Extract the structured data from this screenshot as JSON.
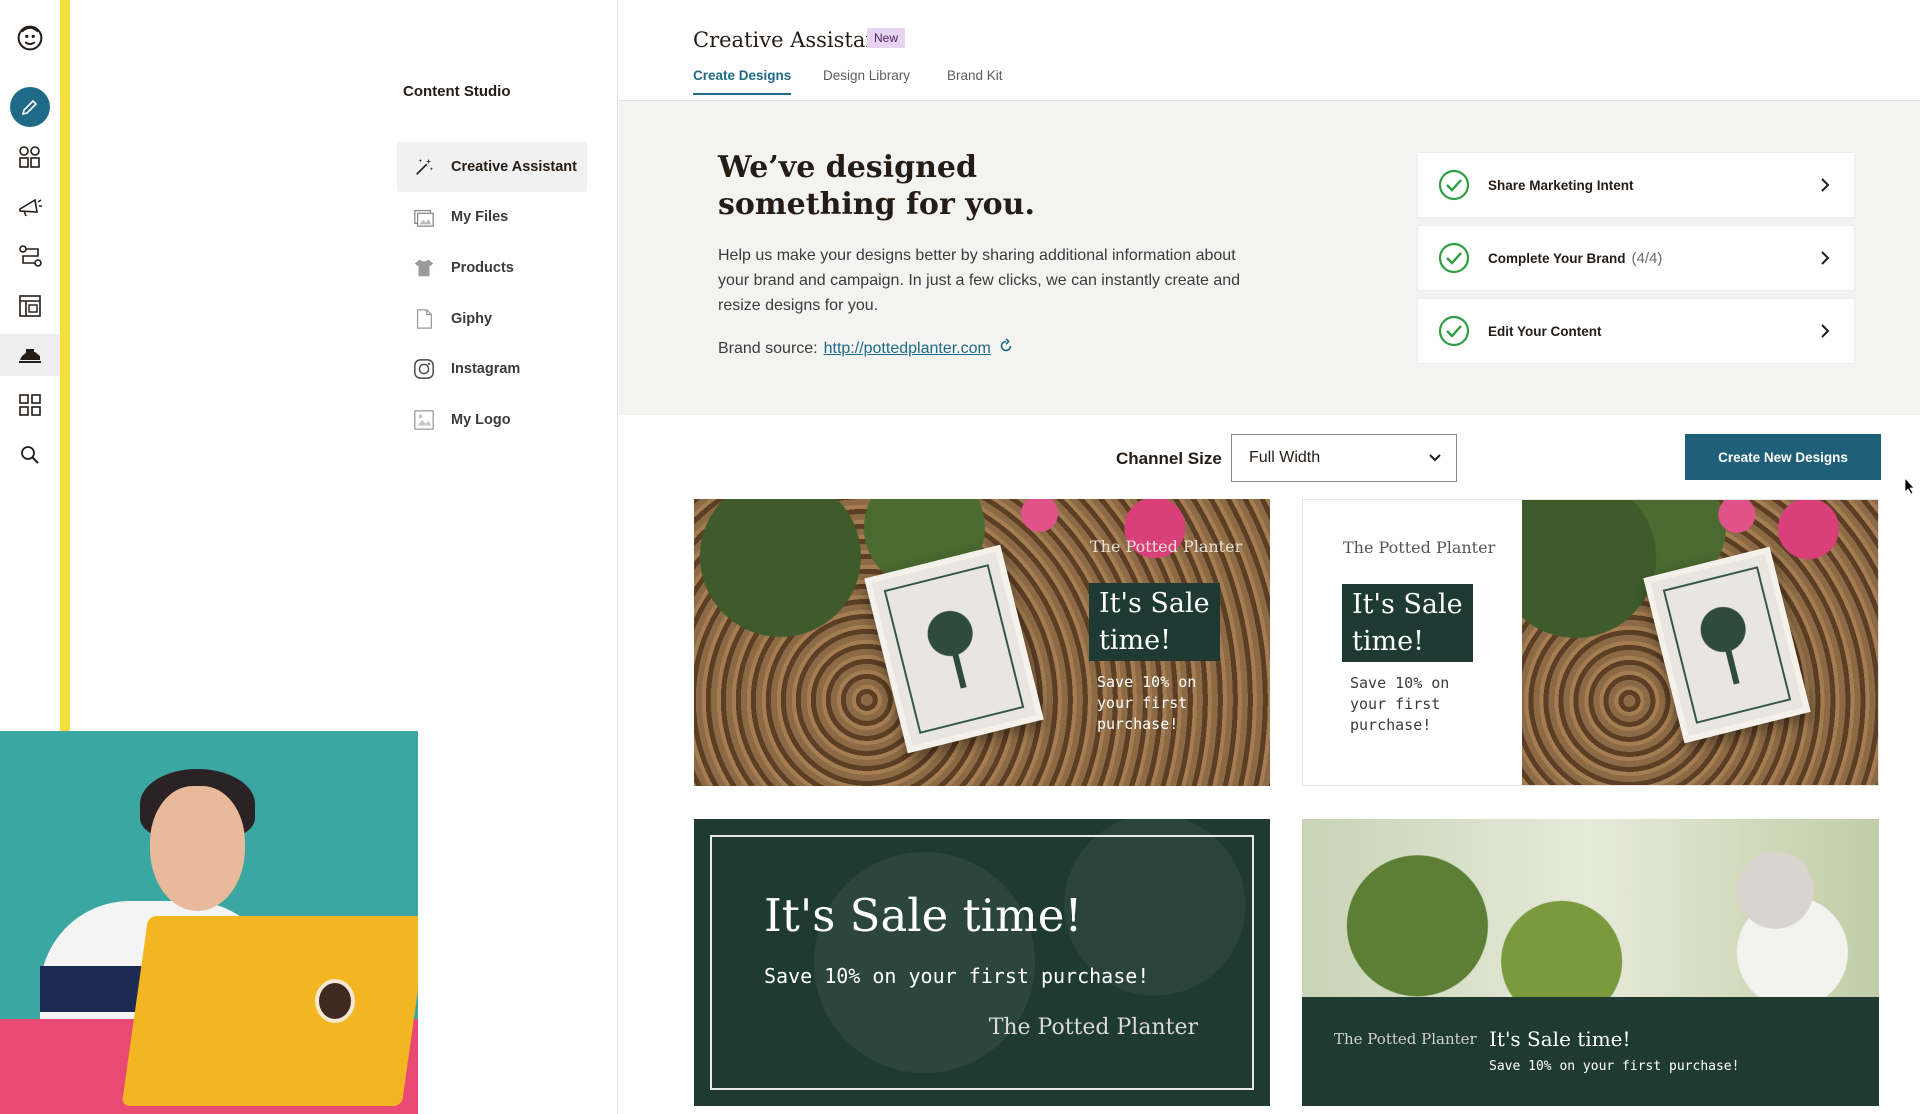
{
  "rail": {
    "icons": [
      "freddie-logo-icon",
      "pencil-icon",
      "audience-icon",
      "megaphone-icon",
      "automations-icon",
      "website-icon",
      "content-studio-icon",
      "grid-icon",
      "search-icon"
    ]
  },
  "studio": {
    "title": "Content Studio",
    "items": [
      {
        "label": "Creative Assistant",
        "icon": "magic-wand-icon"
      },
      {
        "label": "My Files",
        "icon": "images-icon"
      },
      {
        "label": "Products",
        "icon": "tshirt-icon"
      },
      {
        "label": "Giphy",
        "icon": "file-icon"
      },
      {
        "label": "Instagram",
        "icon": "instagram-icon"
      },
      {
        "label": "My Logo",
        "icon": "logo-image-icon"
      }
    ]
  },
  "header": {
    "title": "Creative Assistant",
    "badge": "New",
    "tabs": [
      "Create Designs",
      "Design Library",
      "Brand Kit"
    ],
    "active_tab": "Create Designs"
  },
  "hero": {
    "heading": "We’ve designed something for you.",
    "description": "Help us make your designs better by sharing additional information about your brand and campaign. In just a few clicks, we can instantly create and resize designs for you.",
    "source_label": "Brand source:",
    "source_url": "http://pottedplanter.com",
    "steps": [
      {
        "label": "Share Marketing Intent",
        "count": ""
      },
      {
        "label": "Complete Your Brand",
        "count": "(4/4)"
      },
      {
        "label": "Edit Your Content",
        "count": ""
      }
    ]
  },
  "controls": {
    "channel_label": "Channel Size",
    "channel_value": "Full Width",
    "create_button": "Create New Designs"
  },
  "designs": {
    "brand": "The Potted Planter",
    "headline": "It's Sale time!",
    "headline_line1": "It's Sale",
    "headline_line2": "time!",
    "sub": "Save 10% on your first purchase!",
    "sub_line1": "Save 10% on",
    "sub_line2": "your first",
    "sub_line3": "purchase!"
  },
  "colors": {
    "accent": "#1f6a86",
    "button": "#1f5f78",
    "rail_accent": "#f5df3f",
    "check": "#2f9e44",
    "design_green": "#1f3a31",
    "badge_bg": "#e9d3f3"
  }
}
